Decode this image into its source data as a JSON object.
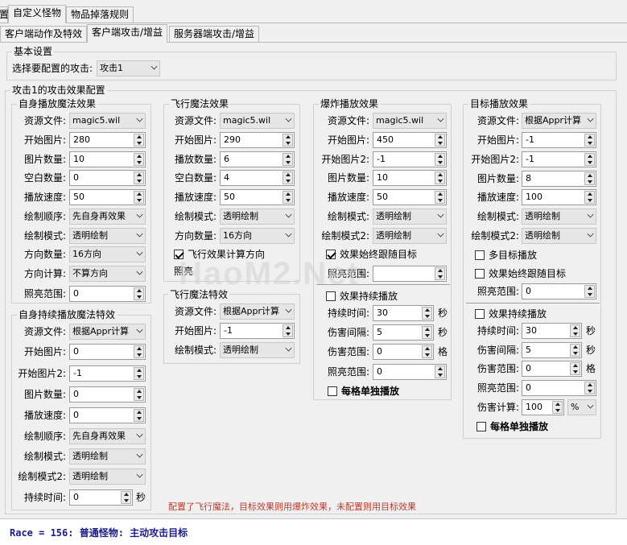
{
  "top_tabs": [
    "置",
    "自定义怪物",
    "物品掉落规则"
  ],
  "sub_tabs": [
    "客户端动作及特效",
    "客户端攻击/增益",
    "服务器端攻击/增益"
  ],
  "basic": {
    "title": "基本设置",
    "select_label": "选择要配置的攻击:",
    "select_value": "攻击1"
  },
  "effect_group_title": "攻击1的攻击效果配置",
  "self_cast": {
    "title": "自身播放魔法效果",
    "res_label": "资源文件:",
    "res_value": "magic5.wil",
    "start_label": "开始图片:",
    "start_value": "280",
    "count_label": "图片数量:",
    "count_value": "10",
    "blank_label": "空白数量:",
    "blank_value": "0",
    "speed_label": "播放速度:",
    "speed_value": "50",
    "order_label": "绘制顺序:",
    "order_value": "先自身再效果",
    "mode_label": "绘制模式:",
    "mode_value": "透明绘制",
    "dircount_label": "方向数量:",
    "dircount_value": "16方向",
    "dircalc_label": "方向计算:",
    "dircalc_value": "不算方向",
    "light_label": "照亮范围:",
    "light_value": "0"
  },
  "self_cont": {
    "title": "自身持续播放魔法特效",
    "res_label": "资源文件:",
    "res_value": "根据Appr计算",
    "start_label": "开始图片:",
    "start_value": "0",
    "start2_label": "开始图片2:",
    "start2_value": "-1",
    "count_label": "图片数量:",
    "count_value": "0",
    "speed_label": "播放速度:",
    "speed_value": "0",
    "order_label": "绘制顺序:",
    "order_value": "先自身再效果",
    "mode_label": "绘制模式:",
    "mode_value": "透明绘制",
    "mode2_label": "绘制模式2:",
    "mode2_value": "透明绘制",
    "duration_label": "持续时间:",
    "duration_value": "0",
    "duration_unit": "秒"
  },
  "fly": {
    "title": "飞行魔法效果",
    "res_label": "资源文件:",
    "res_value": "magic5.wil",
    "start_label": "开始图片:",
    "start_value": "290",
    "count_label": "播放数量:",
    "count_value": "6",
    "blank_label": "空白数量:",
    "blank_value": "4",
    "speed_label": "播放速度:",
    "speed_value": "50",
    "mode_label": "绘制模式:",
    "mode_value": "透明绘制",
    "dircount_label": "方向数量:",
    "dircount_value": "16方向",
    "calc_dir_check": "飞行效果计算方向",
    "light_label": "照亮"
  },
  "fly_fx": {
    "title": "飞行魔法特效",
    "res_label": "资源文件:",
    "res_value": "根据Appr计算",
    "start_label": "开始图片:",
    "start_value": "-1",
    "mode_label": "绘制模式:",
    "mode_value": "透明绘制"
  },
  "explode": {
    "title": "爆炸播放效果",
    "res_label": "资源文件:",
    "res_value": "magic5.wil",
    "start_label": "开始图片:",
    "start_value": "450",
    "start2_label": "开始图片2:",
    "start2_value": "-1",
    "count_label": "图片数量:",
    "count_value": "10",
    "speed_label": "播放速度:",
    "speed_value": "50",
    "mode_label": "绘制模式:",
    "mode_value": "透明绘制",
    "mode2_label": "绘制模式2:",
    "mode2_value": "透明绘制",
    "follow_check": "效果始终跟随目标",
    "light_label": "照亮范围:",
    "cont_check": "效果持续播放",
    "duration_label": "持续时间:",
    "duration_value": "30",
    "duration_unit": "秒",
    "interval_label": "伤害间隔:",
    "interval_value": "5",
    "interval_unit": "秒",
    "range_label": "伤害范围:",
    "range_value": "0",
    "range_unit": "格",
    "light2_label": "照亮范围:",
    "light2_value": "0",
    "single_check": "每格单独播放"
  },
  "target": {
    "title": "目标播放效果",
    "res_label": "资源文件:",
    "res_value": "根据Appr计算",
    "start_label": "开始图片:",
    "start_value": "-1",
    "start2_label": "开始图片2:",
    "start2_value": "-1",
    "count_label": "图片数量:",
    "count_value": "8",
    "speed_label": "播放速度:",
    "speed_value": "100",
    "mode_label": "绘制模式:",
    "mode_value": "透明绘制",
    "mode2_label": "绘制模式2:",
    "mode2_value": "透明绘制",
    "multi_check": "多目标播放",
    "follow_check": "效果始终跟随目标",
    "light_label": "照亮范围:",
    "light_value": "0",
    "cont_check": "效果持续播放",
    "duration_label": "持续时间:",
    "duration_value": "30",
    "duration_unit": "秒",
    "interval_label": "伤害间隔:",
    "interval_value": "5",
    "interval_unit": "秒",
    "range_label": "伤害范围:",
    "range_value": "0",
    "range_unit": "格",
    "light2_label": "照亮范围:",
    "light2_value": "0",
    "calc_label": "伤害计算:",
    "calc_value": "100",
    "calc_unit": "%",
    "single_check": "每格单独播放"
  },
  "note": "配置了飞行魔法，目标效果则用爆炸效果，未配置则用目标效果",
  "watermark": "HaoM2.Net",
  "status": "Race = 156: 普通怪物: 主动攻击目标"
}
